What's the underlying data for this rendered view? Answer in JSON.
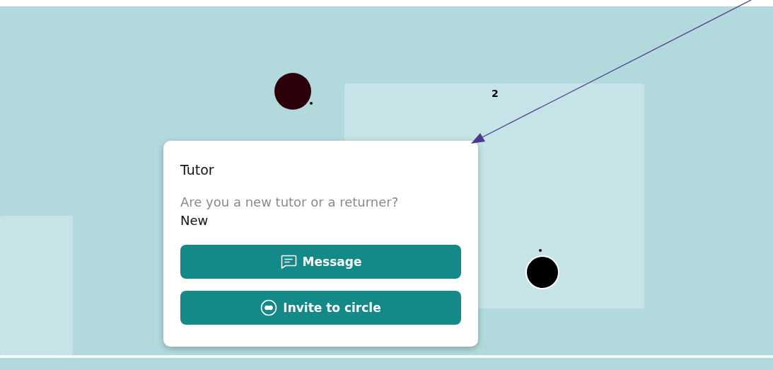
{
  "canvas": {
    "label": "2",
    "markers": [
      {
        "color": "#2b0008"
      },
      {
        "color": "#000000"
      }
    ]
  },
  "card": {
    "title": "Tutor",
    "question": "Are you a new tutor or a returner?",
    "answer": "New",
    "buttons": [
      {
        "label": "Message",
        "kind": "message"
      },
      {
        "label": "Invite to circle",
        "kind": "invite"
      }
    ]
  }
}
